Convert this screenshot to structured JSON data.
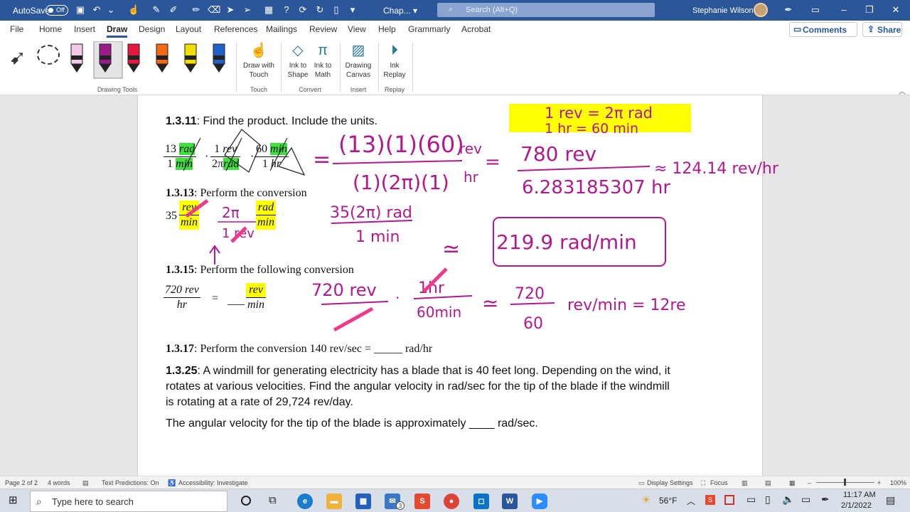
{
  "titlebar": {
    "autosave": "AutoSave",
    "toggle": "Off",
    "doc": "Chap...",
    "search_placeholder": "Search (Alt+Q)",
    "user": "Stephanie Wilson"
  },
  "tabs": [
    "File",
    "Home",
    "Insert",
    "Draw",
    "Design",
    "Layout",
    "References",
    "Mailings",
    "Review",
    "View",
    "Help",
    "Grammarly",
    "Acrobat"
  ],
  "comments": "Comments",
  "share": "Share",
  "ribbon": {
    "draw_with_touch": [
      "Draw with",
      "Touch"
    ],
    "ink_to_shape": [
      "Ink to",
      "Shape"
    ],
    "ink_to_math": [
      "Ink to",
      "Math"
    ],
    "drawing_canvas": [
      "Drawing",
      "Canvas"
    ],
    "ink_replay": [
      "Ink",
      "Replay"
    ],
    "groups": [
      "Drawing Tools",
      "Touch",
      "Convert",
      "Insert",
      "Replay"
    ],
    "pen_colors": [
      "#f4c8e8",
      "#9b1b8c",
      "#e8173c",
      "#f46a14",
      "#f0e000",
      "#2060c8"
    ]
  },
  "doc": {
    "p11_num": "1.3.11",
    "p11_text": ": Find the product. Include the units.",
    "f1": {
      "n1": "13",
      "n1u": "rad",
      "d1": "1",
      "d1u": "min",
      "n2": "1",
      "n2u": "rev",
      "d2": "2π",
      "d2u": "rad",
      "n3": "60",
      "n3u": "min",
      "d3": "1",
      "d3u": "hr"
    },
    "dot": "·",
    "p13_num": "1.3.13",
    "p13_text": ": Perform the conversion",
    "f2": {
      "coef": "35",
      "n": "rev",
      "d": "min",
      "n2": "rad",
      "d2": "min"
    },
    "p15_num": "1.3.15",
    "p15_text": ": Perform the following conversion",
    "f3": {
      "n": "720 rev",
      "d": "hr",
      "eq": "=",
      "blank": "___",
      "n2": "rev",
      "d2": "min"
    },
    "p17_num": "1.3.17",
    "p17_text": ": Perform the conversion 140 rev/sec = _____ rad/hr",
    "p25_num": "1.3.25",
    "p25_text": ": A windmill for generating electricity has a blade that is 40 feet long. Depending on the wind, it",
    "p25_l2": "rotates at various velocities. Find the angular velocity in rad/sec for the tip of the blade if the windmill",
    "p25_l3": "is rotating at a rate of 29,724 rev/day.",
    "p25_ans": "The angular velocity for the tip of the blade is approximately ____ rad/sec."
  },
  "ink": {
    "box": [
      "1 rev = 2π rad",
      "1 hr = 60 min"
    ],
    "eq1_num": "(13)(1)(60)",
    "eq1_den": "(1)(2π)(1)",
    "eq1_units_top": "rev",
    "eq1_units_bot": "hr",
    "eq2_num": "780 rev",
    "eq2_den": "6.283185307 hr",
    "eq2_res": "≈ 124.14 rev/hr",
    "eq3_num": "35(2π) rad",
    "eq3_den": "1 min",
    "eq3_res": "219.9 rad/min",
    "eq4_a": "720 rev",
    "eq4_b": "1hr",
    "eq4_c": "60min",
    "eq4_d": "720",
    "eq4_e": "60",
    "eq4_f": "rev/min = 12re",
    "conv_num": "2π",
    "conv_den": "1 rev"
  },
  "status": {
    "page": "Page 2 of 2",
    "words": "4 words",
    "predictions": "Text Predictions: On",
    "access": "Accessibility: Investigate",
    "display": "Display Settings",
    "focus": "Focus",
    "zoom": "100%"
  },
  "taskbar": {
    "search": "Type here to search",
    "temp": "56°F",
    "time": "11:17 AM",
    "date": "2/1/2022",
    "badge": "3"
  }
}
